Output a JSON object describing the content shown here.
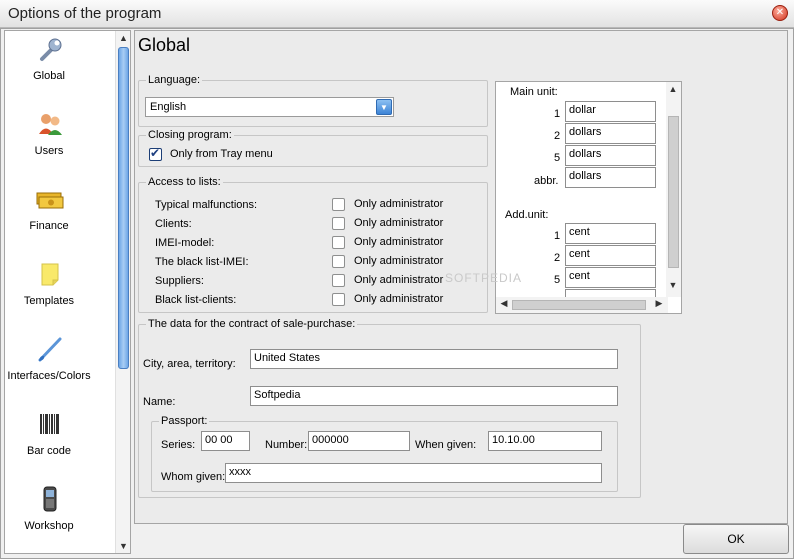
{
  "window": {
    "title": "Options of the program"
  },
  "sidebar": {
    "items": [
      {
        "label": "Global",
        "icon": "wrench-icon"
      },
      {
        "label": "Users",
        "icon": "users-icon"
      },
      {
        "label": "Finance",
        "icon": "money-icon"
      },
      {
        "label": "Templates",
        "icon": "note-icon"
      },
      {
        "label": "Interfaces/Colors",
        "icon": "brush-icon"
      },
      {
        "label": "Bar code",
        "icon": "barcode-icon"
      },
      {
        "label": "Workshop",
        "icon": "phone-icon"
      }
    ]
  },
  "main": {
    "title": "Global",
    "language": {
      "legend": "Language:",
      "value": "English"
    },
    "closing": {
      "legend": "Closing program:",
      "option_label": "Only from Tray menu",
      "checked": true
    },
    "access": {
      "legend": "Access to lists:",
      "rows": [
        {
          "label": "Typical malfunctions:",
          "option": "Only administrator"
        },
        {
          "label": "Clients:",
          "option": "Only administrator"
        },
        {
          "label": "IMEI-model:",
          "option": "Only administrator"
        },
        {
          "label": "The black list-IMEI:",
          "option": "Only administrator"
        },
        {
          "label": "Suppliers:",
          "option": "Only administrator"
        },
        {
          "label": "Black list-clients:",
          "option": "Only administrator"
        }
      ]
    },
    "currency": {
      "main_label": "Main unit:",
      "main": [
        {
          "label": "1",
          "value": "dollar"
        },
        {
          "label": "2",
          "value": "dollars"
        },
        {
          "label": "5",
          "value": "dollars"
        },
        {
          "label": "abbr.",
          "value": "dollars"
        }
      ],
      "add_label": "Add.unit:",
      "add": [
        {
          "label": "1",
          "value": "cent"
        },
        {
          "label": "2",
          "value": "cent"
        },
        {
          "label": "5",
          "value": "cent"
        }
      ]
    },
    "contract": {
      "legend": "The data for the contract of sale-purchase:",
      "city_label": "City, area, territory:",
      "city_value": "United States",
      "name_label": "Name:",
      "name_value": "Softpedia",
      "passport": {
        "legend": "Passport:",
        "series_label": "Series:",
        "series_value": "00 00",
        "number_label": "Number:",
        "number_value": "000000",
        "when_label": "When given:",
        "when_value": "10.10.00",
        "whom_label": "Whom given:",
        "whom_value": "xxxx"
      }
    }
  },
  "footer": {
    "ok_label": "OK"
  },
  "watermark": "SOFTPEDIA"
}
